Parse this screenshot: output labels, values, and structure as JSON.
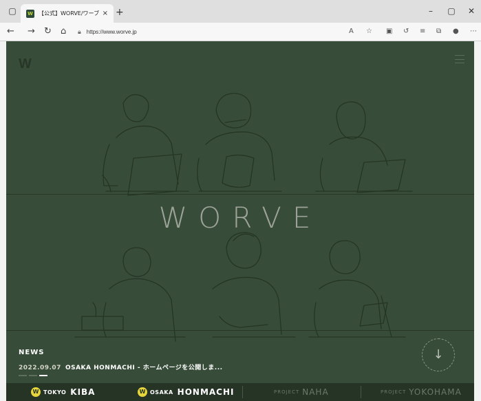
{
  "browser": {
    "tab_title": "【公式】WORVE/ワーブ",
    "tab_close": "×",
    "new_tab": "+",
    "url": "https://www.worve.jp",
    "window_controls": {
      "minimize": "–",
      "maximize": "▢",
      "close": "✕"
    }
  },
  "site": {
    "logo": "W",
    "brand": "WORVE",
    "news": {
      "label": "NEWS",
      "date": "2022.09.07",
      "text": "OSAKA HONMACHI - ホームページを公開しま..."
    },
    "locations": [
      {
        "badge": "W",
        "city": "TOKYO",
        "name": "KIBA"
      },
      {
        "badge": "W",
        "city": "OSAKA",
        "name": "HONMACHI"
      }
    ],
    "projects": [
      {
        "label": "PROJECT",
        "name": "NAHA"
      },
      {
        "label": "PROJECT",
        "name": "YOKOHAMA"
      }
    ]
  },
  "colors": {
    "hero_bg": "#384d39",
    "badge_yellow": "#e7d63b"
  }
}
